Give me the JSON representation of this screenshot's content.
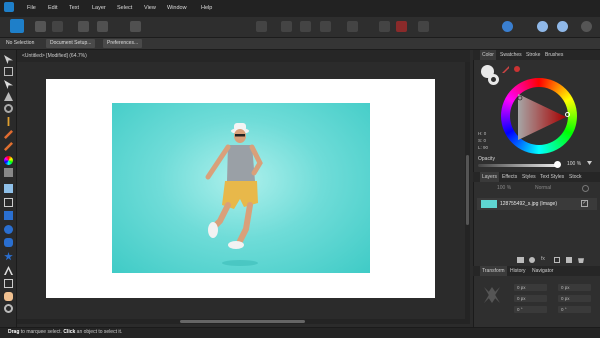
{
  "menubar": {
    "items": [
      "File",
      "Edit",
      "Text",
      "Layer",
      "Select",
      "View",
      "Window",
      "Help"
    ]
  },
  "context_toolbar": {
    "selection_label": "No Selection",
    "document_setup_label": "Document Setup...",
    "preferences_label": "Preferences..."
  },
  "document": {
    "tab_title": "<Untitled> [Modified] (64.7%)"
  },
  "color_panel": {
    "tabs": [
      "Color",
      "Swatches",
      "Stroke",
      "Brushes"
    ],
    "active_tab": "Color",
    "h_label": "H: 0",
    "s_label": "S: 0",
    "l_label": "L: 90",
    "opacity_label": "Opacity",
    "opacity_value": "100 %",
    "opacity_level": 1.0
  },
  "layers_panel": {
    "tabs": [
      "Layers",
      "Effects",
      "Styles",
      "Text Styles",
      "Stock"
    ],
    "active_tab": "Layers",
    "opacity_value": "100 %",
    "blend_mode": "Normal",
    "layers": [
      {
        "name": "128755492_s.jpg",
        "kind": "(Image)",
        "visible": true
      }
    ]
  },
  "transform_panel": {
    "tabs": [
      "Transform",
      "History",
      "Navigator"
    ],
    "active_tab": "Transform",
    "fields": [
      "0 px",
      "0 px",
      "0 px",
      "0 px",
      "0 px",
      "0 px",
      "0 °",
      "0 °"
    ]
  },
  "status": {
    "drag_word": "Drag",
    "drag_text": " to marquee select. ",
    "click_word": "Click",
    "click_text": " an object to select it."
  },
  "colors": {
    "accent": "#1e7fc9",
    "photo_background": "#5fd6d2"
  }
}
